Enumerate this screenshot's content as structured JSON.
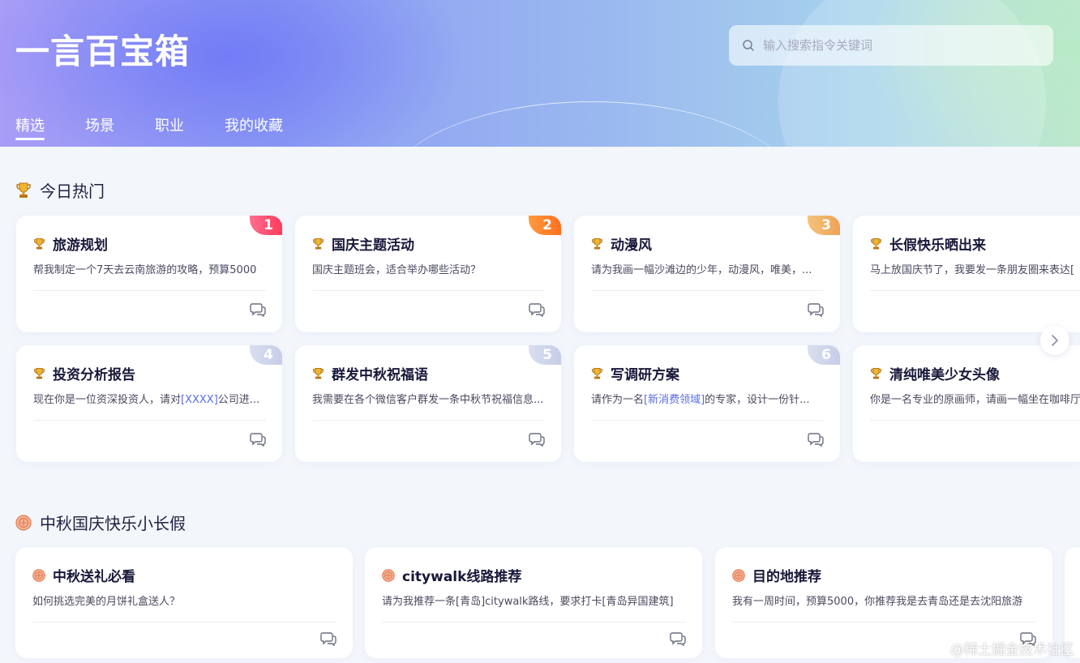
{
  "header": {
    "title": "一言百宝箱",
    "search_placeholder": "输入搜索指令关键词",
    "tabs": [
      {
        "label": "精选",
        "active": true
      },
      {
        "label": "场景",
        "active": false
      },
      {
        "label": "职业",
        "active": false
      },
      {
        "label": "我的收藏",
        "active": false
      }
    ]
  },
  "hot_section": {
    "title": "今日热门",
    "icon": "trophy-icon",
    "cards": [
      {
        "rank": "1",
        "title": "旅游规划",
        "desc": "帮我制定一个7天去云南旅游的攻略，预算5000"
      },
      {
        "rank": "2",
        "title": "国庆主题活动",
        "desc": "国庆主题班会，适合举办哪些活动？"
      },
      {
        "rank": "3",
        "title": "动漫风",
        "desc": "请为我画一幅沙滩边的少年，动漫风，唯美，..."
      },
      {
        "rank": "",
        "title": "长假快乐晒出来",
        "desc": "马上放国庆节了，我要发一条朋友圈来表达["
      },
      {
        "rank": "4",
        "title": "投资分析报告",
        "desc_pre": "现在你是一位资深投资人，请对",
        "desc_hl": "[XXXX]",
        "desc_post": "公司进..."
      },
      {
        "rank": "5",
        "title": "群发中秋祝福语",
        "desc": "我需要在各个微信客户群发一条中秋节祝福信息..."
      },
      {
        "rank": "6",
        "title": "写调研方案",
        "desc_pre": "请作为一名",
        "desc_hl": "[新消费领域]",
        "desc_post": "的专家，设计一份针..."
      },
      {
        "rank": "",
        "title": "清纯唯美少女头像",
        "desc": "你是一名专业的原画师，请画一幅坐在咖啡厅"
      }
    ]
  },
  "holiday_section": {
    "title": "中秋国庆快乐小长假",
    "icon": "mooncake-icon",
    "cards": [
      {
        "title": "中秋送礼必看",
        "desc": "如何挑选完美的月饼礼盒送人？"
      },
      {
        "title": "citywalk线路推荐",
        "desc": "请为我推荐一条[青岛]citywalk路线，要求打卡[青岛异国建筑]"
      },
      {
        "title": "目的地推荐",
        "desc": "我有一周时间，预算5000，你推荐我是去青岛还是去沈阳旅游"
      }
    ]
  },
  "watermark": "@稀土掘金技术社区",
  "colors": {
    "accent": "#5a6ce8",
    "rank1": "#ff3a5c",
    "rank2": "#ff6f1e",
    "rank3": "#eea354",
    "rank_other": "#c6cde6"
  }
}
